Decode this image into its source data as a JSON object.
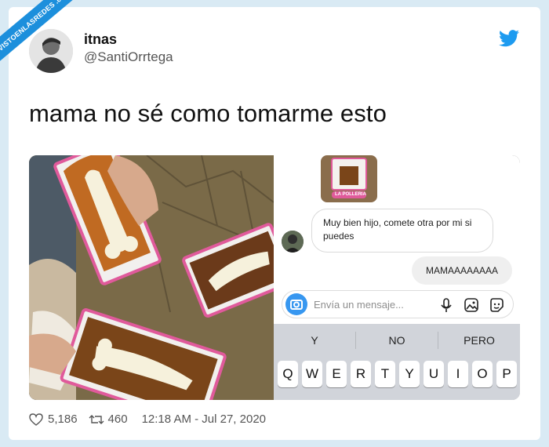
{
  "watermark": "VISTOENLASREDES .com",
  "author": {
    "name": "itnas",
    "handle": "@SantiOrrtega"
  },
  "tweet": {
    "text": "mama no sé como tomarme esto"
  },
  "chat": {
    "story_tag": "LA POLLERIA",
    "received_message": "Muy bien hijo, comete otra por mi si puedes",
    "sent_message": "MAMAAAAAAAA",
    "input_placeholder": "Envía un mensaje...",
    "suggestions": [
      "Y",
      "NO",
      "PERO"
    ],
    "keys": [
      "Q",
      "W",
      "E",
      "R",
      "T",
      "Y",
      "U",
      "I",
      "O",
      "P"
    ]
  },
  "stats": {
    "likes": "5,186",
    "retweets": "460",
    "timestamp": "12:18 AM - Jul 27, 2020"
  },
  "colors": {
    "brand": "#1d9bf0",
    "background": "#d9eaf4",
    "instagram_blue": "#3797f0"
  }
}
